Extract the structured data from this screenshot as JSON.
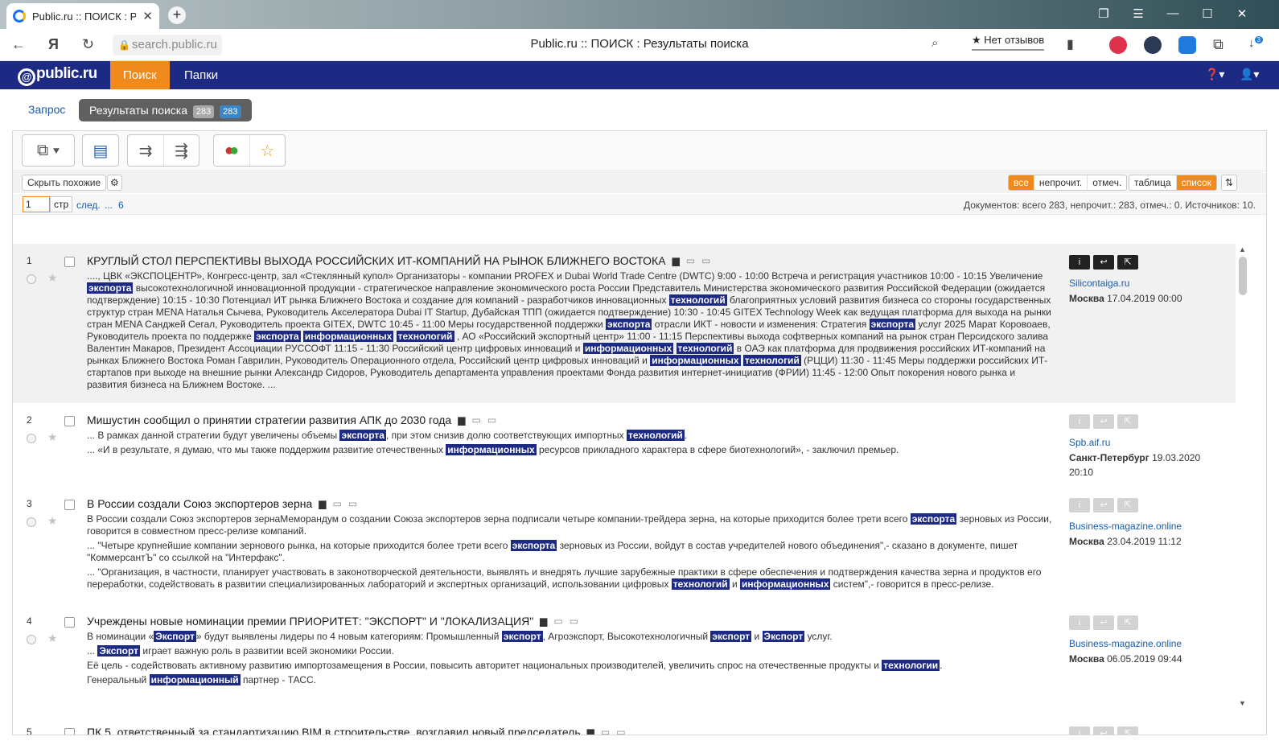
{
  "browser": {
    "tab_title": "Public.ru :: ПОИСК : Рез",
    "url": "search.public.ru",
    "page_title": "Public.ru :: ПОИСК : Результаты поиска",
    "reviews": "★ Нет отзывов",
    "icons": [
      "back-icon",
      "yandex-icon",
      "reload-icon",
      "lock-icon",
      "bookmark-icon",
      "download-icon"
    ],
    "download_badge": "3"
  },
  "header": {
    "logo": "public.ru",
    "nav": [
      {
        "label": "Поиск",
        "active": true
      },
      {
        "label": "Папки",
        "active": false
      }
    ]
  },
  "crumbs": {
    "query": "Запрос",
    "results": "Результаты поиска",
    "count_grey": "283",
    "count_blue": "283"
  },
  "toolbar": {
    "buttons": [
      "select-all-icon",
      "export-word-icon",
      "copy-to-folder-icon",
      "move-to-folder-icon",
      "color-mark-icon",
      "favorites-icon"
    ]
  },
  "filters": {
    "hide_similar": "Скрыть похожие",
    "segments": [
      {
        "label": "все",
        "on": true
      },
      {
        "label": "непрочит.",
        "on": false
      },
      {
        "label": "отмеч.",
        "on": false
      }
    ],
    "views": [
      {
        "label": "таблица",
        "on": false
      },
      {
        "label": "список",
        "on": true
      }
    ]
  },
  "pager": {
    "page": "1",
    "unit": "стр",
    "next": "след.",
    "dots": "...",
    "last": "6",
    "stats": "Документов: всего 283, непрочит.: 283, отмеч.: 0. Источников: 10."
  },
  "results": [
    {
      "num": "1",
      "title": "КРУГЛЫЙ СТОЛ ПЕРСПЕКТИВЫ ВЫХОДА РОССИЙСКИХ ИТ-КОМПАНИЙ НА РЫНОК БЛИЖНЕГО ВОСТОКА",
      "highlighted": true,
      "source": "Silicontaiga.ru",
      "city": "Москва",
      "date": "17.04.2019 00:00",
      "paragraphs": [
        [
          {
            "t": "...., ЦВК «ЭКСПОЦЕНТР», Конгресс-центр, зал «Стеклянный купол» Организаторы - компании PROFEX и Dubai World Trade Centre (DWTC) 9:00 - 10:00 Встреча и регистрация участников 10:00 - 10:15 Увеличение "
          },
          {
            "t": "экспорта",
            "h": true
          },
          {
            "t": " высокотехнологичной инновационной продукции - стратегическое направление экономического роста России Представитель Министерства экономического развития Российской Федерации (ожидается подтверждение) 10:15 - 10:30 Потенциал ИТ рынка Ближнего Востока и создание для компаний - разработчиков инновационных "
          },
          {
            "t": "технологий",
            "h": true
          },
          {
            "t": " благоприятных условий развития бизнеса со стороны государственных структур стран MENA Наталья Сычева, Руководитель Акселератора Dubai IT Startup, Дубайская ТПП (ожидается подтверждение) 10:30 - 10:45 GITEX Technology Week как ведущая платформа для выхода на рынки стран MENA Санджей Сегал, Руководитель проекта GITEX, DWTC 10:45 - 11:00 Меры государственной поддержки "
          },
          {
            "t": "экспорта",
            "h": true
          },
          {
            "t": " отрасли ИКТ - новости и изменения: Стратегия "
          },
          {
            "t": "экспорта",
            "h": true
          },
          {
            "t": " услуг 2025 Марат Коровоаев, Руководитель проекта по поддержке "
          },
          {
            "t": "экспорта",
            "h": true
          },
          {
            "t": " "
          },
          {
            "t": "информационных",
            "h": true
          },
          {
            "t": " "
          },
          {
            "t": "технологий",
            "h": true
          },
          {
            "t": " , АО «Российский экспортный центр» 11:00 - 11:15 Перспективы выхода софтверных компаний на рынок стран Персидского залива Валентин Макаров, Президент Ассоциации РУССОФТ 11:15 - 11:30 Российский центр цифровых инноваций и "
          },
          {
            "t": "информационных",
            "h": true
          },
          {
            "t": " "
          },
          {
            "t": "технологий",
            "h": true
          },
          {
            "t": " в ОАЭ как платформа для продвижения российских ИТ-компаний на рынках Ближнего Востока Роман Гаврилин, Руководитель Операционного отдела, Российский центр цифровых инноваций и "
          },
          {
            "t": "информационных",
            "h": true
          },
          {
            "t": " "
          },
          {
            "t": "технологий",
            "h": true
          },
          {
            "t": " (РЦЦИ) 11:30 - 11:45 Меры поддержки российских ИТ-стартапов при выходе на внешние рынки Александр Сидоров, Руководитель департамента управления проектами Фонда развития интернет-инициатив (ФРИИ) 11:45 - 12:00 Опыт покорения нового рынка и развития бизнеса на Ближнем Востоке. ..."
          }
        ]
      ]
    },
    {
      "num": "2",
      "title": "Мишустин сообщил о принятии стратегии развития АПК до 2030 года",
      "highlighted": false,
      "source": "Spb.aif.ru",
      "city": "Санкт-Петербург",
      "date": "19.03.2020 20:10",
      "paragraphs": [
        [
          {
            "t": "... В рамках данной стратегии будут увеличены объемы "
          },
          {
            "t": "экспорта",
            "h": true
          },
          {
            "t": ", при этом снизив долю соответствующих импортных "
          },
          {
            "t": "технологий",
            "h": true
          },
          {
            "t": "."
          }
        ],
        [
          {
            "t": "... «И в результате, я думаю, что мы также поддержим развитие отечественных "
          },
          {
            "t": "информационных",
            "h": true
          },
          {
            "t": " ресурсов прикладного характера в сфере биотехнологий», - заключил премьер."
          }
        ]
      ]
    },
    {
      "num": "3",
      "title": "В России создали Союз экспортеров зерна",
      "highlighted": false,
      "source": "Business-magazine.online",
      "city": "Москва",
      "date": "23.04.2019 11:12",
      "paragraphs": [
        [
          {
            "t": "В России создали Союз экспортеров зернаМеморандум о создании Союза экспортеров зерна подписали четыре компании-трейдера зерна, на которые приходится более трети всего "
          },
          {
            "t": "экспорта",
            "h": true
          },
          {
            "t": " зерновых из России, говорится в совместном пресс-релизе компаний."
          }
        ],
        [
          {
            "t": "... \"Четыре крупнейшие компании зернового рынка, на которые приходится более трети всего "
          },
          {
            "t": "экспорта",
            "h": true
          },
          {
            "t": " зерновых из России, войдут в состав учредителей нового объединения\",- сказано в документе, пишет \"КоммерсантЪ\" со ссылкой на \"Интерфакс\"."
          }
        ],
        [
          {
            "t": "... \"Организация, в частности, планирует участвовать в законотворческой деятельности, выявлять и внедрять лучшие зарубежные практики в сфере обеспечения и подтверждения качества зерна и продуктов его переработки, содействовать в развитии специализированных лабораторий и экспертных организаций, использовании цифровых "
          },
          {
            "t": "технологий",
            "h": true
          },
          {
            "t": " и "
          },
          {
            "t": "информационных",
            "h": true
          },
          {
            "t": " систем\",- говорится в пресс-релизе."
          }
        ]
      ]
    },
    {
      "num": "4",
      "title": "Учреждены новые номинации премии ПРИОРИТЕТ: \"ЭКСПОРТ\" И \"ЛОКАЛИЗАЦИЯ\"",
      "highlighted": false,
      "source": "Business-magazine.online",
      "city": "Москва",
      "date": "06.05.2019 09:44",
      "paragraphs": [
        [
          {
            "t": "В номинации «"
          },
          {
            "t": "Экспорт",
            "h": true
          },
          {
            "t": "» будут выявлены лидеры по 4 новым категориям: Промышленный "
          },
          {
            "t": "экспорт",
            "h": true
          },
          {
            "t": ", Агроэкспорт, Высокотехнологичный "
          },
          {
            "t": "экспорт",
            "h": true
          },
          {
            "t": " и "
          },
          {
            "t": "Экспорт",
            "h": true
          },
          {
            "t": " услуг."
          }
        ],
        [
          {
            "t": "... "
          },
          {
            "t": "Экспорт",
            "h": true
          },
          {
            "t": " играет важную роль в развитии всей экономики России."
          }
        ],
        [
          {
            "t": "Её цель - содействовать активному развитию импортозамещения в России, повысить авторитет национальных производителей, увеличить спрос на отечественные продукты и "
          },
          {
            "t": "технологии",
            "h": true
          },
          {
            "t": "."
          }
        ],
        [
          {
            "t": "Генеральный "
          },
          {
            "t": "информационный",
            "h": true
          },
          {
            "t": " партнер - ТАСС."
          }
        ]
      ]
    },
    {
      "num": "5",
      "title": "ПК 5, ответственный за стандартизацию BIM в строительстве, возглавил новый председатель",
      "highlighted": false,
      "source": "",
      "city": "",
      "date": "",
      "paragraphs": []
    }
  ]
}
